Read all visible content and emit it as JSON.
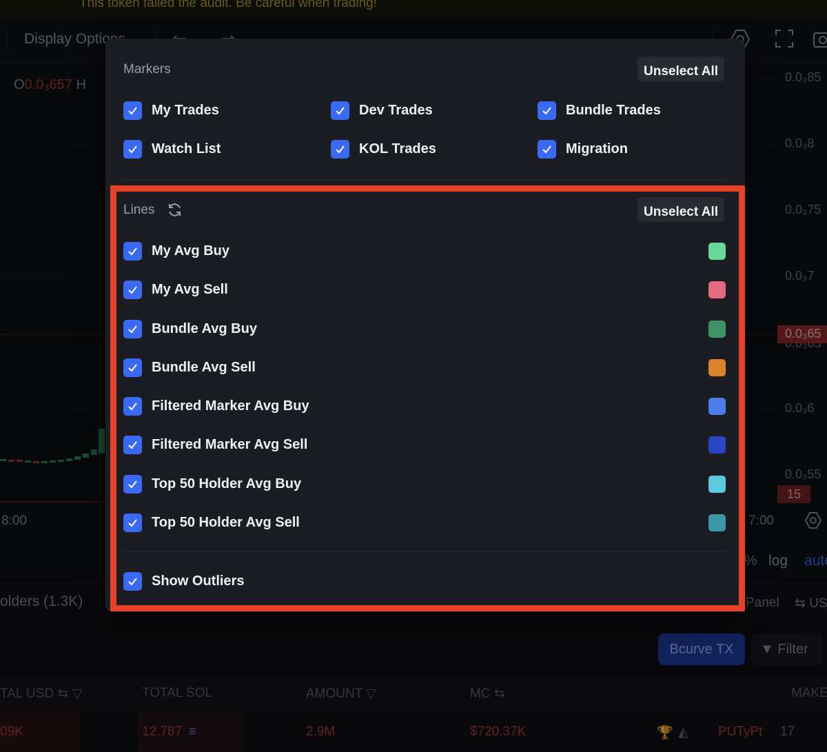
{
  "banner": {
    "text": "This token failed the audit. Be careful when trading!"
  },
  "toolbar": {
    "display_options": "Display Options"
  },
  "chart": {
    "ohlc_o": "O",
    "ohlc_value": "0.0₃657",
    "ohlc_h": "H",
    "price_labels": [
      "0.0₃85",
      "0.0₃8",
      "0.0₃75",
      "0.0₃7",
      "0.0₃65",
      "0.0₃6",
      "0.0₃55"
    ],
    "current_price": "0.0₃65",
    "volume_tag": "15",
    "time_left": "8:00",
    "time_right": "7:00",
    "pct": "%",
    "log": "log",
    "auto": "auto"
  },
  "tabs": {
    "holders": "olders (1.3K)",
    "panel": "Panel",
    "us": "US"
  },
  "filters": {
    "bcurve": "Bcurve TX",
    "filter": "Filter"
  },
  "table": {
    "headers": [
      "TAL  USD ⇆ ▽",
      "TOTAL SOL",
      "AMOUNT ▽",
      "MC ⇆",
      "MAKER"
    ],
    "row": {
      "total_usd": "09K",
      "total_sol": "12.787",
      "amount": "2.9M",
      "mc": "$720.37K",
      "maker": "PUTyPt",
      "count": "17"
    }
  },
  "popup": {
    "markers": {
      "title": "Markers",
      "unselect_all": "Unselect All",
      "items": [
        {
          "label": "My Trades",
          "checked": true
        },
        {
          "label": "Dev Trades",
          "checked": true
        },
        {
          "label": "Bundle Trades",
          "checked": true
        },
        {
          "label": "Watch List",
          "checked": true
        },
        {
          "label": "KOL Trades",
          "checked": true
        },
        {
          "label": "Migration",
          "checked": true
        }
      ]
    },
    "lines": {
      "title": "Lines",
      "unselect_all": "Unselect All",
      "items": [
        {
          "label": "My Avg Buy",
          "checked": true,
          "color": "#6ad79b"
        },
        {
          "label": "My Avg Sell",
          "checked": true,
          "color": "#e36a7f"
        },
        {
          "label": "Bundle Avg Buy",
          "checked": true,
          "color": "#3f9467"
        },
        {
          "label": "Bundle Avg Sell",
          "checked": true,
          "color": "#d9832b"
        },
        {
          "label": "Filtered Marker Avg Buy",
          "checked": true,
          "color": "#4a7de8"
        },
        {
          "label": "Filtered Marker Avg Sell",
          "checked": true,
          "color": "#2a46c4"
        },
        {
          "label": "Top 50 Holder Avg Buy",
          "checked": true,
          "color": "#5bc9df"
        },
        {
          "label": "Top 50 Holder Avg Sell",
          "checked": true,
          "color": "#3a98a6"
        }
      ],
      "show_outliers": {
        "label": "Show Outliers",
        "checked": true
      }
    }
  }
}
